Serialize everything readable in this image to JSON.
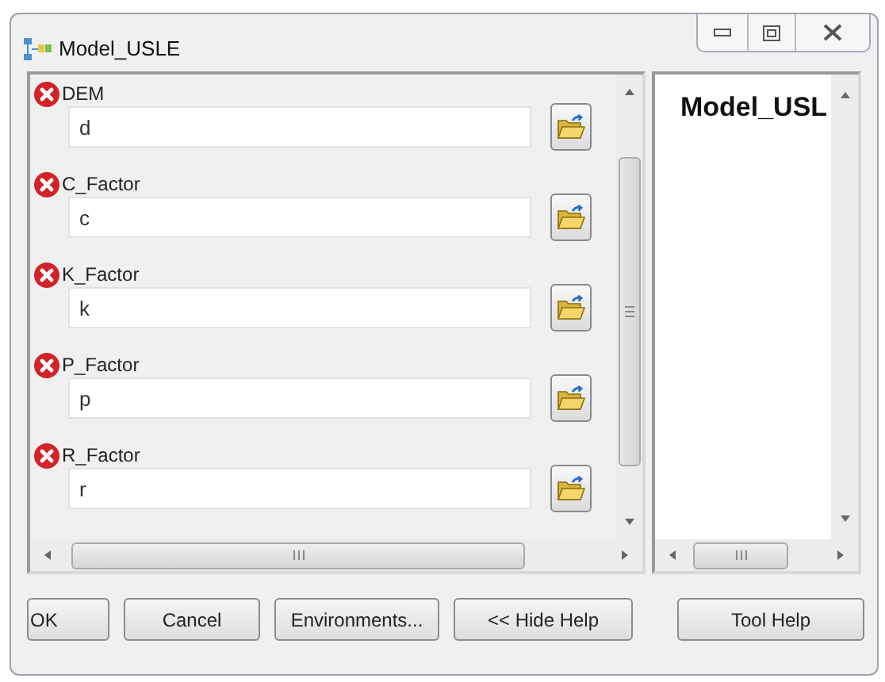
{
  "window": {
    "title": "Model_USLE"
  },
  "parameters": [
    {
      "label": "DEM",
      "value": "d",
      "error": true
    },
    {
      "label": "C_Factor",
      "value": "c",
      "error": true
    },
    {
      "label": "K_Factor",
      "value": "k",
      "error": true
    },
    {
      "label": "P_Factor",
      "value": "p",
      "error": true
    },
    {
      "label": "R_Factor",
      "value": "r",
      "error": true
    }
  ],
  "help": {
    "title": "Model_USL"
  },
  "buttons": [
    "OK",
    "Cancel",
    "Environments...",
    "<< Hide Help",
    "Tool Help"
  ]
}
